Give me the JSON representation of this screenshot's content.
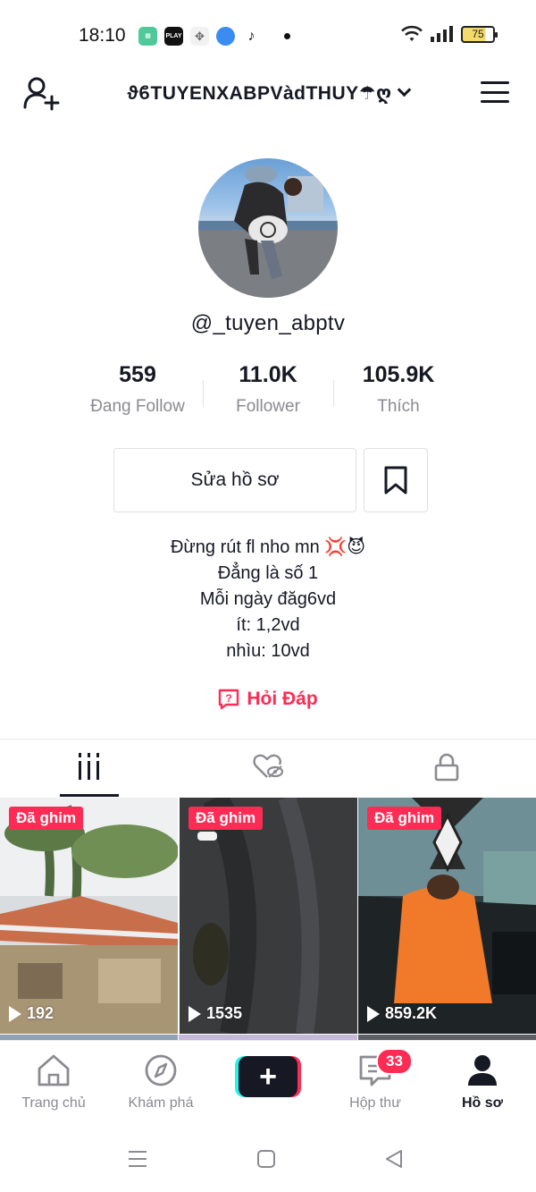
{
  "status_bar": {
    "time": "18:10",
    "apps": [
      "calculator-app-icon",
      "play-together-app-icon",
      "game-controller-icon",
      "blue-app-icon",
      "tiktok-icon"
    ],
    "play_label": "PLAY",
    "battery": "75"
  },
  "header": {
    "handle": "ϑϐTUYENXABPVàdTHUY☂ღ"
  },
  "profile": {
    "username": "@_tuyen_abptv"
  },
  "stats": [
    {
      "value": "559",
      "label": "Đang Follow"
    },
    {
      "value": "11.0K",
      "label": "Follower"
    },
    {
      "value": "105.9K",
      "label": "Thích"
    }
  ],
  "actions": {
    "edit_label": "Sửa hồ sơ"
  },
  "bio": {
    "lines": [
      "Đừng rút fl nho mn 💢😈",
      "Đẳng là số 1",
      "Mỗi ngày đăg6vd",
      "ít: 1,2vd",
      "nhìu: 10vd"
    ]
  },
  "qa_label": "Hỏi Đáp",
  "videos": [
    {
      "pinned": "Đã ghim",
      "views": "192"
    },
    {
      "pinned": "Đã ghim",
      "views": "1535"
    },
    {
      "pinned": "Đã ghim",
      "views": "859.2K"
    }
  ],
  "bottom_nav": {
    "items": [
      {
        "label": "Trang chủ"
      },
      {
        "label": "Khám phá"
      },
      {
        "label": "Hộp thư"
      },
      {
        "label": "Hồ sơ"
      }
    ],
    "inbox_badge": "33"
  },
  "colors": {
    "accent": "#fe2c55",
    "text": "#161823",
    "muted": "#8a8b91"
  }
}
